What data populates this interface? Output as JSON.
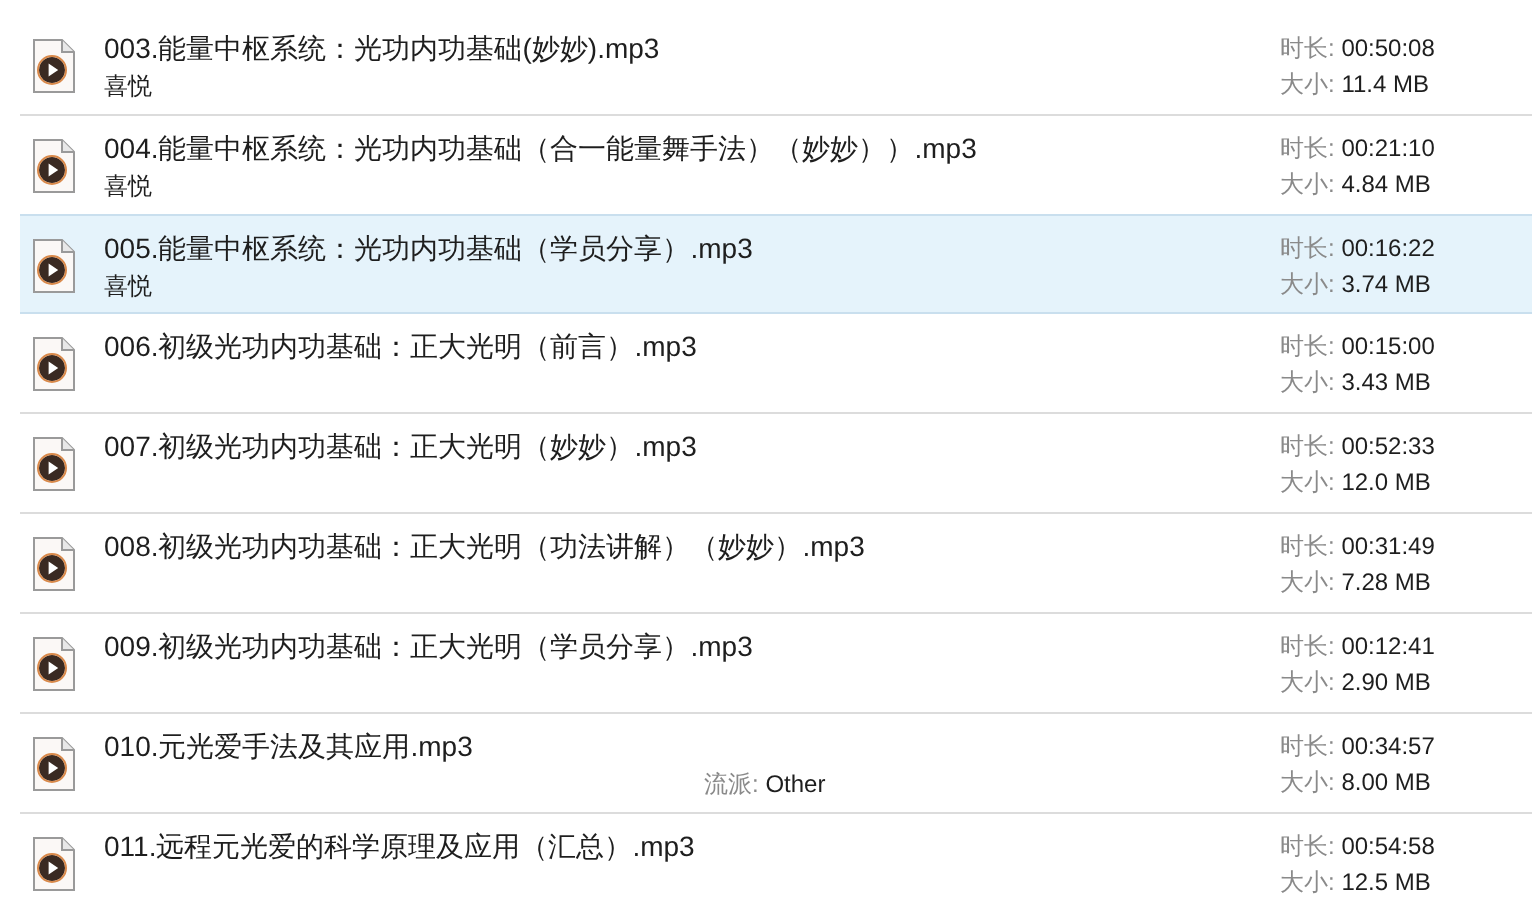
{
  "files": [
    {
      "title": "003.能量中枢系统：光功内功基础(妙妙).mp3",
      "artist": "喜悦",
      "duration_label": "时长:",
      "duration": "00:50:08",
      "size_label": "大小:",
      "size": "11.4 MB",
      "selected": false
    },
    {
      "title": "004.能量中枢系统：光功内功基础（合一能量舞手法）（妙妙））.mp3",
      "artist": "喜悦",
      "duration_label": "时长:",
      "duration": "00:21:10",
      "size_label": "大小:",
      "size": "4.84 MB",
      "selected": false
    },
    {
      "title": "005.能量中枢系统：光功内功基础（学员分享）.mp3",
      "artist": "喜悦",
      "duration_label": "时长:",
      "duration": "00:16:22",
      "size_label": "大小:",
      "size": "3.74 MB",
      "selected": true
    },
    {
      "title": "006.初级光功内功基础：正大光明（前言）.mp3",
      "duration_label": "时长:",
      "duration": "00:15:00",
      "size_label": "大小:",
      "size": "3.43 MB",
      "selected": false
    },
    {
      "title": "007.初级光功内功基础：正大光明（妙妙）.mp3",
      "duration_label": "时长:",
      "duration": "00:52:33",
      "size_label": "大小:",
      "size": "12.0 MB",
      "selected": false
    },
    {
      "title": "008.初级光功内功基础：正大光明（功法讲解）（妙妙）.mp3",
      "duration_label": "时长:",
      "duration": "00:31:49",
      "size_label": "大小:",
      "size": "7.28 MB",
      "selected": false
    },
    {
      "title": "009.初级光功内功基础：正大光明（学员分享）.mp3",
      "duration_label": "时长:",
      "duration": "00:12:41",
      "size_label": "大小:",
      "size": "2.90 MB",
      "selected": false
    },
    {
      "title": "010.元光爱手法及其应用.mp3",
      "genre_label": "流派:",
      "genre": "Other",
      "duration_label": "时长:",
      "duration": "00:34:57",
      "size_label": "大小:",
      "size": "8.00 MB",
      "selected": false
    },
    {
      "title": "011.远程元光爱的科学原理及应用（汇总）.mp3",
      "duration_label": "时长:",
      "duration": "00:54:58",
      "size_label": "大小:",
      "size": "12.5 MB",
      "selected": false
    }
  ]
}
